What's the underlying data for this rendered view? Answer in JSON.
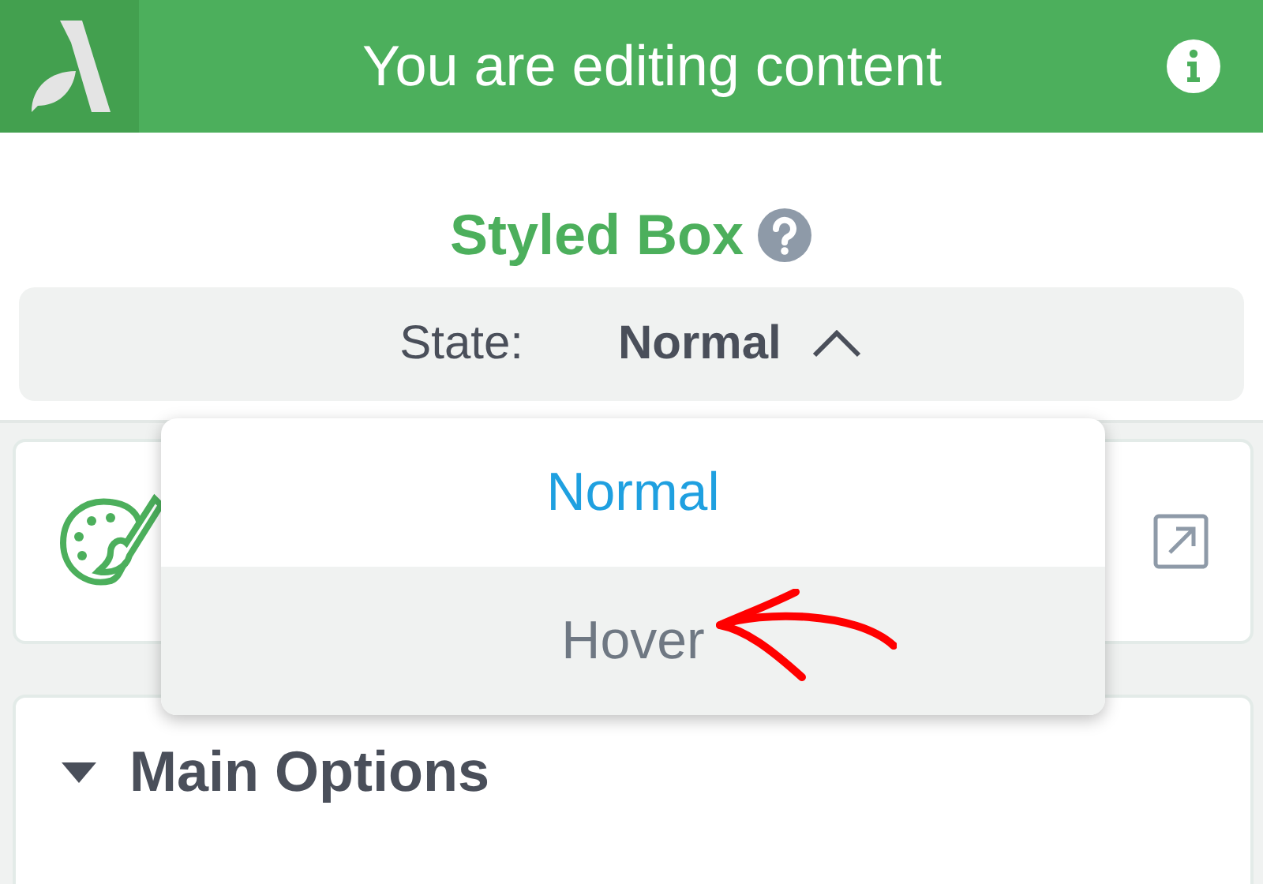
{
  "header": {
    "title": "You are editing content"
  },
  "element": {
    "title": "Styled Box"
  },
  "state_select": {
    "label": "State:",
    "value": "Normal",
    "expanded": true,
    "options": [
      {
        "label": "Normal",
        "selected": true,
        "hovered": false
      },
      {
        "label": "Hover",
        "selected": false,
        "hovered": true
      }
    ]
  },
  "sections": [
    {
      "title": "Main Options",
      "expanded": true
    }
  ]
}
